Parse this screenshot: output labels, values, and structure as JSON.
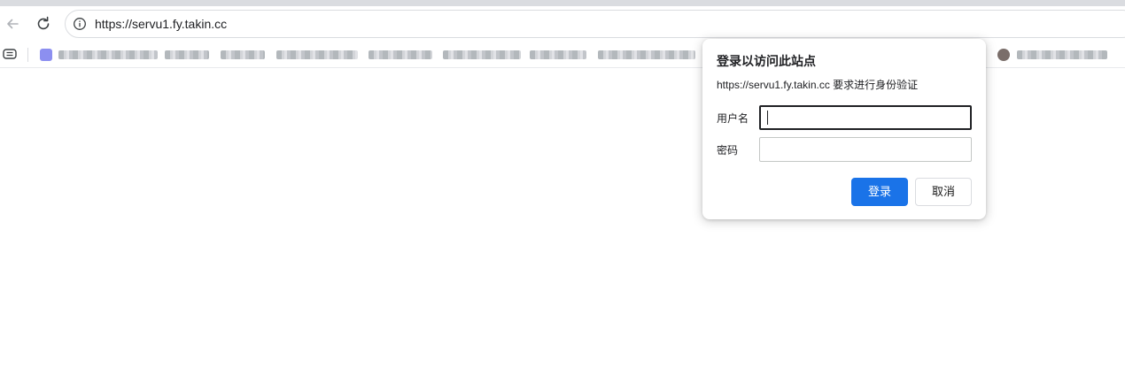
{
  "browser": {
    "url": "https://servu1.fy.takin.cc",
    "back_icon": "back-arrow-icon",
    "reload_icon": "reload-icon",
    "site_info_icon": "info-icon"
  },
  "bookmarks_bar": {
    "apps_icon": "tab-group-icon",
    "blurred": true
  },
  "auth_dialog": {
    "title": "登录以访问此站点",
    "subtitle": "https://servu1.fy.takin.cc 要求进行身份验证",
    "username_label": "用户名",
    "username_value": "",
    "password_label": "密码",
    "password_value": "",
    "login_button": "登录",
    "cancel_button": "取消",
    "accent_color": "#1a73e8"
  }
}
